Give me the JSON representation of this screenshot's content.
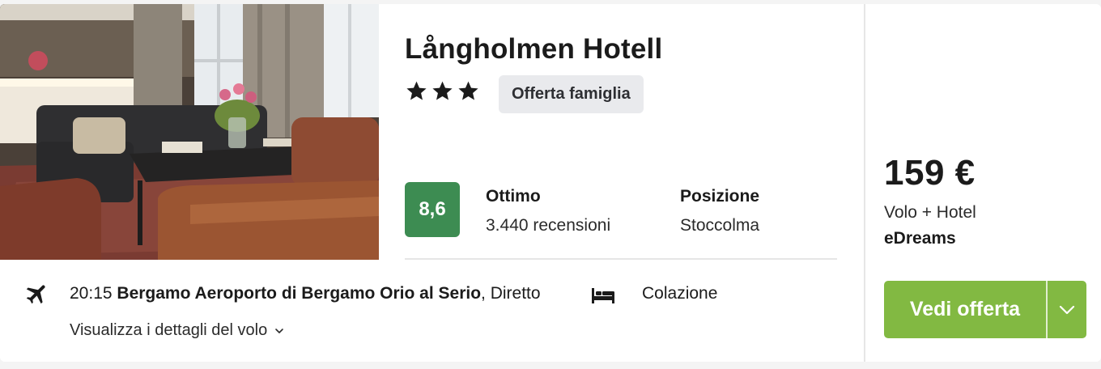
{
  "hotel": {
    "name": "Långholmen Hotell",
    "star_rating": 3,
    "badge": "Offerta famiglia"
  },
  "rating": {
    "score": "8,6",
    "label": "Ottimo",
    "reviews": "3.440 recensioni"
  },
  "location": {
    "label": "Posizione",
    "value": "Stoccolma"
  },
  "flight": {
    "time": "20:15",
    "airport": "Bergamo Aeroporto di Bergamo Orio al Serio",
    "type": "Diretto",
    "meal": "Colazione",
    "details_link": "Visualizza i dettagli del volo"
  },
  "price": {
    "amount": "159 €",
    "package": "Volo + Hotel",
    "provider": "eDreams"
  },
  "cta": {
    "label": "Vedi offerta"
  },
  "colors": {
    "score_bg": "#3d8c52",
    "cta_bg": "#82b942",
    "badge_bg": "#e9eaed"
  },
  "icons": [
    "star-icon",
    "plane-icon",
    "bed-icon",
    "chevron-down-icon"
  ]
}
